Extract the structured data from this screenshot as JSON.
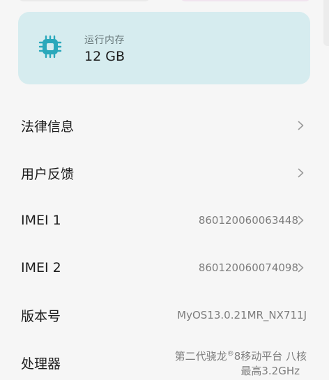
{
  "memory_card": {
    "label": "运行内存",
    "value": "12 GB",
    "icon": "chip-icon",
    "accent": "#2aa8bb",
    "background": "#d6ecef"
  },
  "rows": [
    {
      "label": "法律信息",
      "value": "",
      "chevron": true
    },
    {
      "label": "用户反馈",
      "value": "",
      "chevron": true
    },
    {
      "label": "IMEI 1",
      "value": "860120060063448",
      "chevron": true
    },
    {
      "label": "IMEI 2",
      "value": "860120060074098",
      "chevron": true
    },
    {
      "label": "版本号",
      "value": "MyOS13.0.21MR_NX711J",
      "chevron": false
    }
  ],
  "processor": {
    "label": "处理器",
    "value_prefix": "第二代骁龙",
    "value_mark": "®",
    "value_suffix": "8移动平台 八核",
    "value_line2": "最高3.2GHz"
  }
}
